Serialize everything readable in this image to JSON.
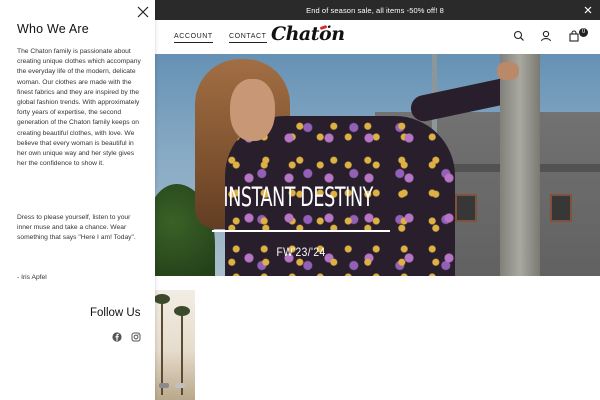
{
  "announcement": {
    "text": "End of season sale, all items -50% off! 8"
  },
  "nav": {
    "fragment_label": "",
    "account_label": "ACCOUNT",
    "contact_label": "CONTACT"
  },
  "logo": {
    "text": "Chatön"
  },
  "cart": {
    "count": "0"
  },
  "hero": {
    "title": "INSTANT DESTINY",
    "subtitle": "FW'23/'24"
  },
  "drawer": {
    "title": "Who We Are",
    "body": "The Chaton family is passionate about creating unique clothes which accompany the everyday life of the modern, delicate woman.  Our clothes are made with the finest fabrics and they are inspired by the global fashion trends. With approximately forty years of expertise, the second generation of the Chaton family keeps on creating beautiful clothes, with love. We believe that every woman is beautiful in her own unique way and her style gives her the confidence to show it.",
    "body2": "Dress to please yourself, listen to your inner muse and take a chance. Wear something that says \"Here I am! Today\".",
    "quote": "- Iris Apfel",
    "follow_title": "Follow Us"
  },
  "icons": {
    "announce_close": "close-icon",
    "drawer_close": "close-icon",
    "search": "search-icon",
    "account": "user-icon",
    "cart": "shopping-bag-icon",
    "facebook": "facebook-icon",
    "instagram": "instagram-icon"
  },
  "colors": {
    "announcement_bg": "#2a2a2a",
    "logo_accent": "#d9262e",
    "text": "#222222"
  }
}
